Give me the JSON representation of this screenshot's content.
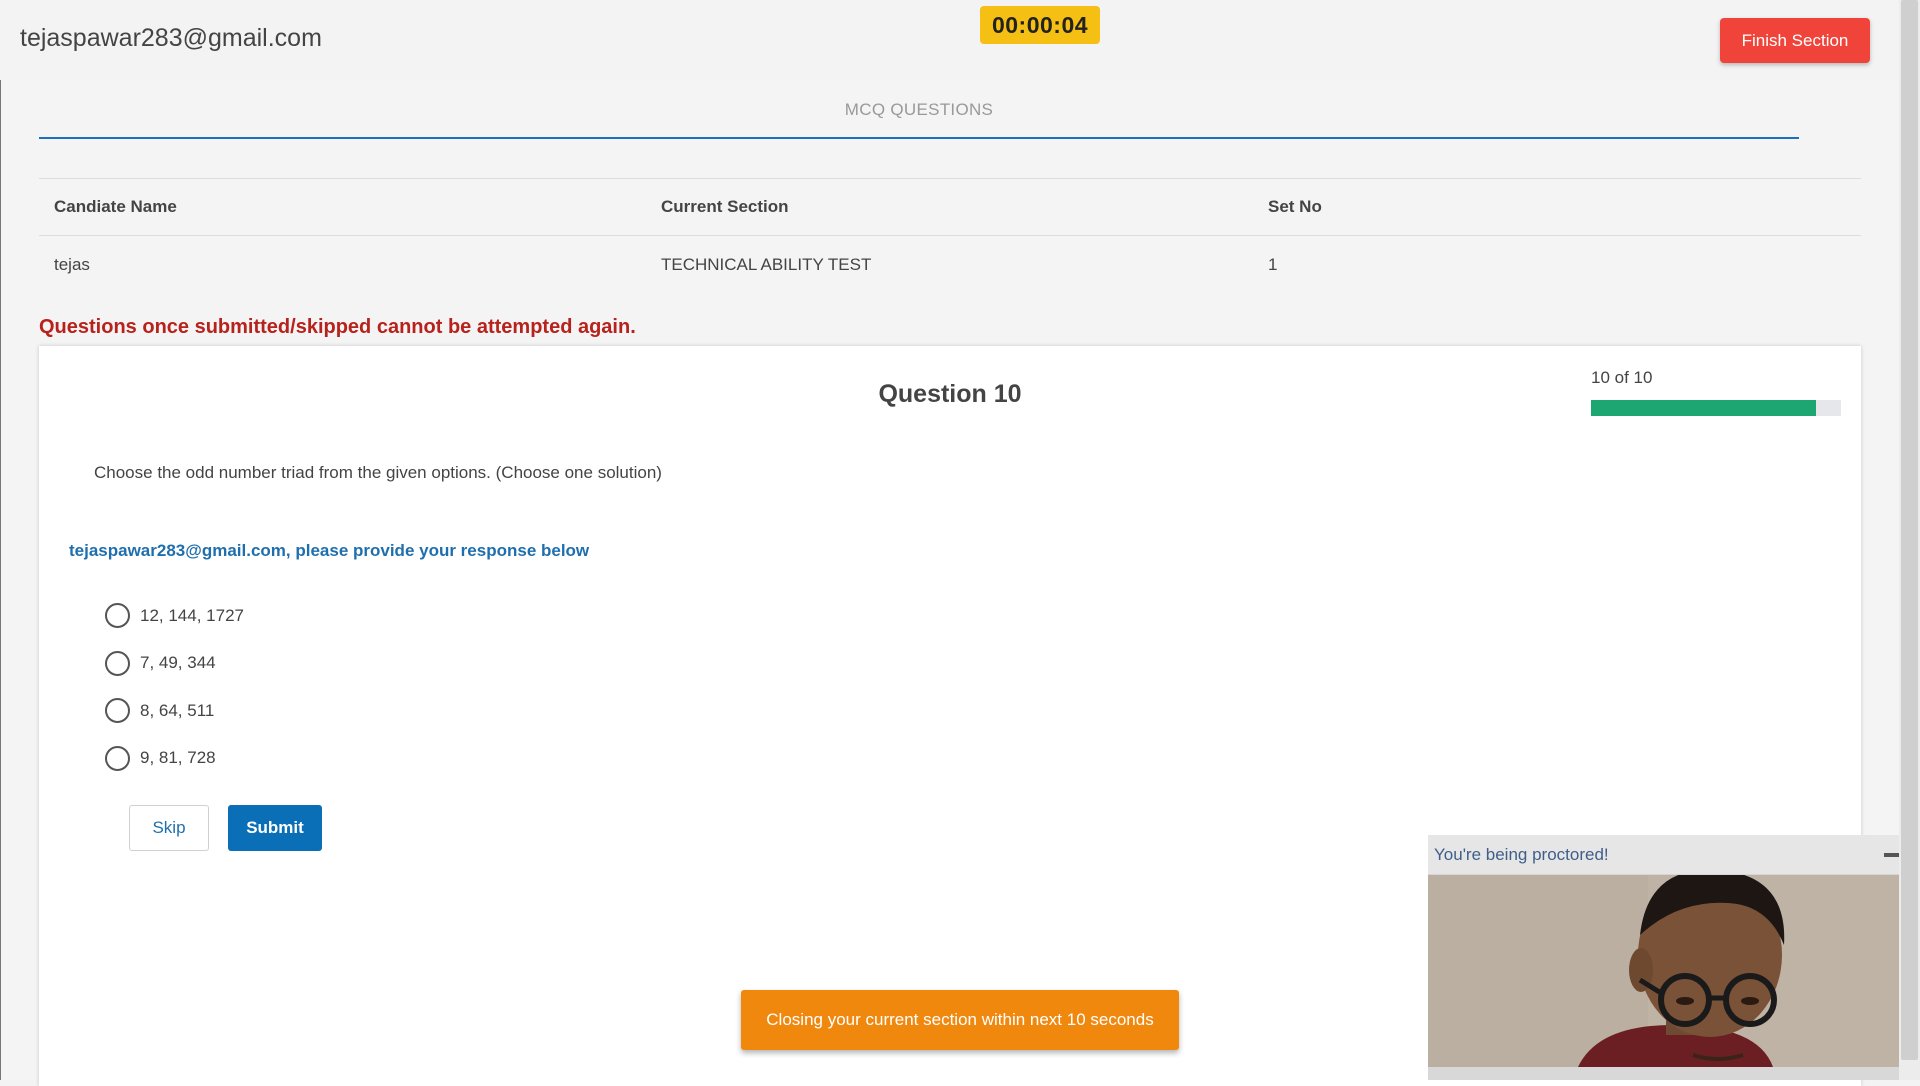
{
  "header": {
    "user_email": "tejaspawar283@gmail.com",
    "timer": "00:00:04",
    "finish_label": "Finish Section"
  },
  "section": {
    "title": "MCQ QUESTIONS"
  },
  "info_table": {
    "headers": [
      "Candiate Name",
      "Current Section",
      "Set No"
    ],
    "values": [
      "tejas",
      "TECHNICAL ABILITY TEST",
      "1"
    ]
  },
  "warning": "Questions once submitted/skipped cannot be attempted again.",
  "question": {
    "title": "Question 10",
    "progress_label": "10 of 10",
    "progress_fraction": 0.9,
    "text": "Choose the odd number triad from the given options. (Choose one solution)",
    "prompt": "tejaspawar283@gmail.com, please provide your response below",
    "options": [
      "12, 144, 1727",
      "7, 49, 344",
      "8, 64, 511",
      "9, 81, 728"
    ],
    "skip_label": "Skip",
    "submit_label": "Submit"
  },
  "toast": "Closing your current section within next 10 seconds",
  "proctor": {
    "title": "You're being proctored!"
  },
  "colors": {
    "timer_bg": "#f5c013",
    "finish_bg": "#f0433a",
    "progress_fill": "#1ea672",
    "submit_bg": "#0b6fb8",
    "toast_bg": "#f0880e",
    "warning_text": "#b8221c"
  }
}
